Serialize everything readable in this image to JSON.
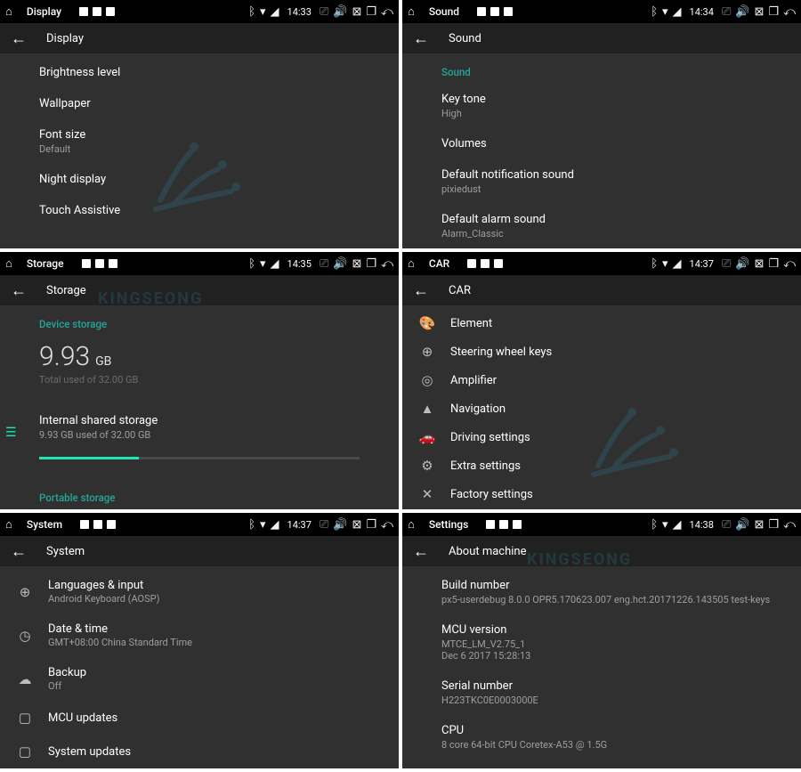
{
  "panels": [
    {
      "statusTitle": "Display",
      "time": "14:33",
      "subTitle": "Display",
      "items": [
        {
          "primary": "Brightness level"
        },
        {
          "primary": "Wallpaper"
        },
        {
          "primary": "Font size",
          "secondary": "Default"
        },
        {
          "primary": "Night display"
        },
        {
          "primary": "Touch Assistive"
        }
      ]
    },
    {
      "statusTitle": "Sound",
      "time": "14:34",
      "subTitle": "Sound",
      "section": "Sound",
      "items": [
        {
          "primary": "Key tone",
          "secondary": "High"
        },
        {
          "primary": "Volumes"
        },
        {
          "primary": "Default notification sound",
          "secondary": "pixiedust"
        },
        {
          "primary": "Default alarm sound",
          "secondary": "Alarm_Classic"
        }
      ]
    },
    {
      "statusTitle": "Storage",
      "time": "14:35",
      "subTitle": "Storage",
      "deviceSection": "Device storage",
      "usedNum": "9.93",
      "usedUnit": "GB",
      "usedCaption": "Total used of 32.00 GB",
      "internal": {
        "primary": "Internal shared storage",
        "secondary": "9.93 GB used of 32.00 GB"
      },
      "progressPct": 31,
      "portableSection": "Portable storage"
    },
    {
      "statusTitle": "CAR",
      "time": "14:37",
      "subTitle": "CAR",
      "items": [
        {
          "icon": "palette",
          "primary": "Element"
        },
        {
          "icon": "steering",
          "primary": "Steering wheel keys"
        },
        {
          "icon": "amp",
          "primary": "Amplifier"
        },
        {
          "icon": "nav",
          "primary": "Navigation"
        },
        {
          "icon": "car",
          "primary": "Driving settings"
        },
        {
          "icon": "extra",
          "primary": "Extra settings"
        },
        {
          "icon": "tools",
          "primary": "Factory settings"
        }
      ]
    },
    {
      "statusTitle": "System",
      "time": "14:37",
      "subTitle": "System",
      "items": [
        {
          "icon": "globe",
          "primary": "Languages & input",
          "secondary": "Android Keyboard (AOSP)"
        },
        {
          "icon": "clock",
          "primary": "Date & time",
          "secondary": "GMT+08:00 China Standard Time"
        },
        {
          "icon": "cloud",
          "primary": "Backup",
          "secondary": "Off"
        },
        {
          "icon": "device",
          "primary": "MCU updates"
        },
        {
          "icon": "device",
          "primary": "System updates"
        }
      ]
    },
    {
      "statusTitle": "Settings",
      "time": "14:38",
      "subTitle": "About machine",
      "items": [
        {
          "primary": "Build number",
          "secondary": "px5-userdebug 8.0.0 OPR5.170623.007 eng.hct.20171226.143505 test-keys"
        },
        {
          "primary": "MCU version",
          "secondary": "MTCE_LM_V2.75_1\nDec  6 2017 15:28:13"
        },
        {
          "primary": "Serial number",
          "secondary": "H223TKC0E0003000E"
        },
        {
          "primary": "CPU",
          "secondary": "8 core 64-bit CPU Coretex-A53 @ 1.5G"
        }
      ]
    }
  ],
  "watermarkText": "KINGSEONG",
  "iconGlyphs": {
    "palette": "🎨",
    "steering": "⊕",
    "amp": "◎",
    "nav": "▲",
    "car": "🚗",
    "extra": "⚙",
    "tools": "✕",
    "globe": "⊕",
    "clock": "◷",
    "cloud": "☁",
    "device": "▢"
  }
}
